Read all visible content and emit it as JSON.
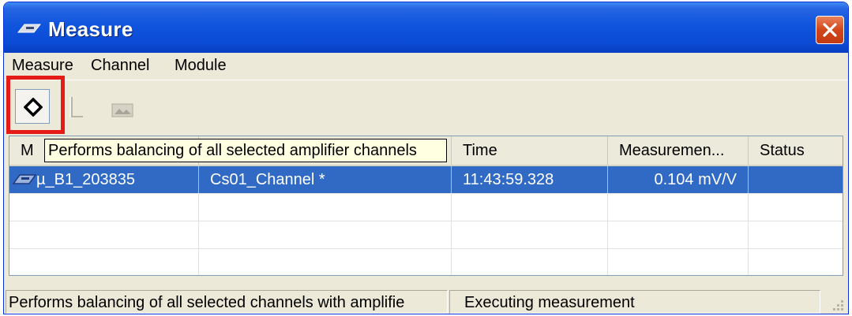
{
  "window": {
    "title": "Measure",
    "app_icon": "module-icon",
    "close_icon": "close-icon",
    "colors": {
      "titlebar": "#0b4bd6",
      "close": "#d2461b",
      "selection": "#316ac5",
      "highlight": "#e41b17",
      "tooltip": "#ffffe1"
    }
  },
  "menu": [
    {
      "label": "Measure"
    },
    {
      "label": "Channel"
    },
    {
      "label": "Module"
    }
  ],
  "toolbar": {
    "buttons": [
      {
        "icon": "balance-diamond-icon",
        "enabled": true,
        "highlighted": true
      },
      {
        "icon": "zero-bracket-icon",
        "enabled": false
      },
      {
        "icon": "image-icon",
        "enabled": false
      }
    ]
  },
  "tooltip": {
    "text": "Performs balancing of all selected amplifier channels"
  },
  "table": {
    "columns": [
      "M",
      "",
      "Time",
      "Measuremen...",
      "Status"
    ],
    "rows": [
      {
        "module": "µ_B1_203835",
        "channel": "Cs01_Channel  *",
        "time": "11:43:59.328",
        "measurement": "0.104 mV/V",
        "status": "",
        "selected": true
      }
    ],
    "empty_rows": 3
  },
  "statusbar": {
    "left": "Performs balancing of all selected channels with amplifie",
    "right": "Executing measurement"
  }
}
